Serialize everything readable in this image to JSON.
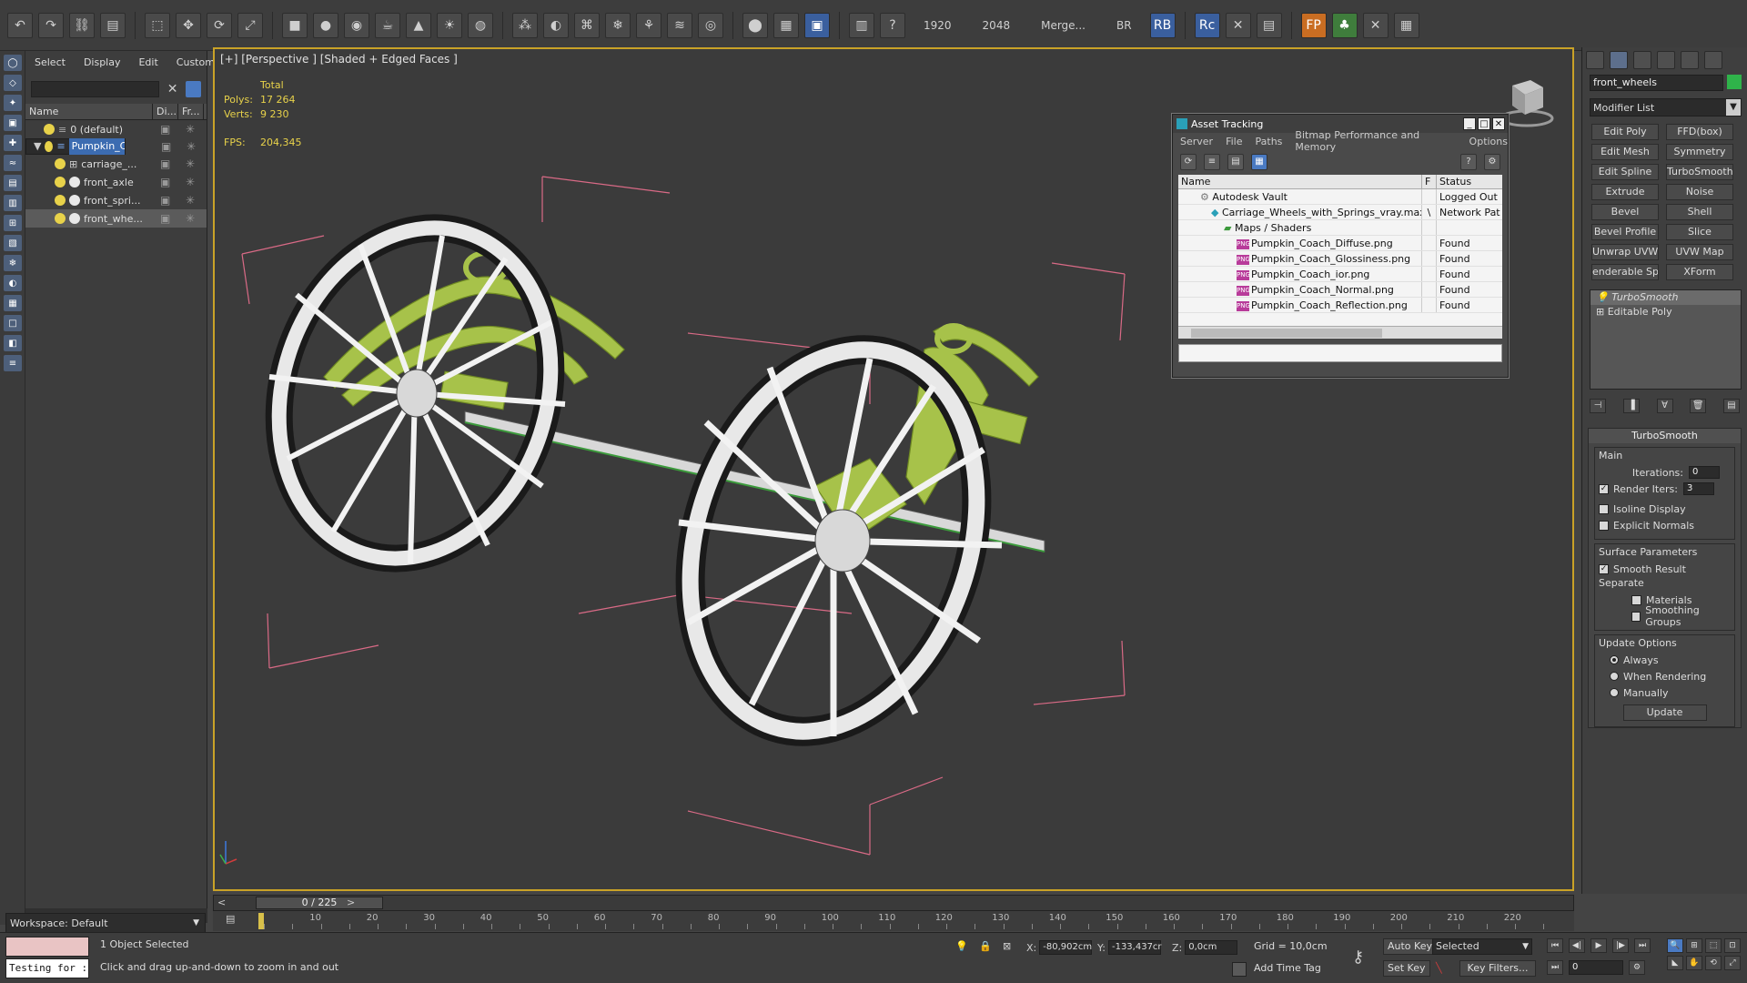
{
  "toolbar": {
    "res1": "1920",
    "res2": "2048",
    "merge": "Merge...",
    "br": "BR",
    "rb": "RB",
    "rc": "Rc",
    "fp": "FP"
  },
  "scene_explorer": {
    "menus": [
      "Select",
      "Display",
      "Edit",
      "Customize"
    ],
    "columns": [
      "Name",
      "Di...",
      "Fr..."
    ],
    "rows": [
      {
        "label": "0 (default)"
      },
      {
        "label": "Pumpkin_Coach"
      },
      {
        "label": "carriage_..."
      },
      {
        "label": "front_axle"
      },
      {
        "label": "front_spri..."
      },
      {
        "label": "front_whe..."
      }
    ],
    "workspace": "Workspace: Default"
  },
  "viewport": {
    "label": "[+] [Perspective ] [Shaded + Edged Faces ]",
    "stats_total": "Total",
    "polys_label": "Polys:",
    "polys_value": "17 264",
    "verts_label": "Verts:",
    "verts_value": "9 230",
    "fps_label": "FPS:",
    "fps_value": "204,345"
  },
  "asset_tracking": {
    "title": "Asset Tracking",
    "menu": [
      "Server",
      "File",
      "Paths",
      "Bitmap Performance and Memory",
      "Options"
    ],
    "columns": {
      "name": "Name",
      "f": "F",
      "status": "Status"
    },
    "rows": [
      {
        "name": "Autodesk Vault",
        "f": "",
        "status": "Logged Out ("
      },
      {
        "name": "Carriage_Wheels_with_Springs_vray.max",
        "f": "\\",
        "status": "Network Path"
      },
      {
        "name": "Maps / Shaders",
        "f": "",
        "status": ""
      },
      {
        "name": "Pumpkin_Coach_Diffuse.png",
        "f": "",
        "status": "Found"
      },
      {
        "name": "Pumpkin_Coach_Glossiness.png",
        "f": "",
        "status": "Found"
      },
      {
        "name": "Pumpkin_Coach_ior.png",
        "f": "",
        "status": "Found"
      },
      {
        "name": "Pumpkin_Coach_Normal.png",
        "f": "",
        "status": "Found"
      },
      {
        "name": "Pumpkin_Coach_Reflection.png",
        "f": "",
        "status": "Found"
      }
    ],
    "png_tag": "PNG"
  },
  "command_panel": {
    "object_name": "front_wheels",
    "modifier_list": "Modifier List",
    "modifiers": [
      "Edit Poly",
      "FFD(box)",
      "Edit Mesh",
      "Symmetry",
      "Edit Spline",
      "TurboSmooth",
      "Extrude",
      "Noise",
      "Bevel",
      "Shell",
      "Bevel Profile",
      "Slice",
      "Unwrap UVW",
      "UVW Map",
      "enderable Splir",
      "XForm"
    ],
    "stack": [
      "TurboSmooth",
      "Editable Poly"
    ],
    "rollout_title": "TurboSmooth",
    "main": "Main",
    "iterations_label": "Iterations:",
    "iterations_value": "0",
    "render_iters_label": "Render Iters:",
    "render_iters_value": "3",
    "isoline": "Isoline Display",
    "explicit_normals": "Explicit Normals",
    "surface_params": "Surface Parameters",
    "smooth_result": "Smooth Result",
    "separate": "Separate",
    "materials": "Materials",
    "smoothing_groups": "Smoothing Groups",
    "update_options": "Update Options",
    "always": "Always",
    "when_rendering": "When Rendering",
    "manually": "Manually",
    "update": "Update"
  },
  "timeline": {
    "frame": "0 / 225",
    "ticks": [
      "10",
      "20",
      "30",
      "40",
      "50",
      "60",
      "70",
      "80",
      "90",
      "100",
      "110",
      "120",
      "130",
      "140",
      "150",
      "160",
      "170",
      "180",
      "190",
      "200",
      "210",
      "220"
    ]
  },
  "statusbar": {
    "testing": "Testing for :",
    "selected": "1 Object Selected",
    "prompt": "Click and drag up-and-down to zoom in and out",
    "x_label": "X:",
    "x_value": "-80,902cm",
    "y_label": "Y:",
    "y_value": "-133,437cr",
    "z_label": "Z:",
    "z_value": "0,0cm",
    "grid": "Grid = 10,0cm",
    "add_time_tag": "Add Time Tag",
    "auto_key": "Auto Key",
    "set_key": "Set Key",
    "selected_dropdown": "Selected",
    "key_filters": "Key Filters...",
    "frame_field": "0"
  },
  "colors": {
    "accent": "#3c6cb1",
    "viewport_border": "#c9a227",
    "stats_text": "#e8d24a",
    "spring_green": "#a7c24a",
    "bbox_pink": "#d96a86"
  }
}
